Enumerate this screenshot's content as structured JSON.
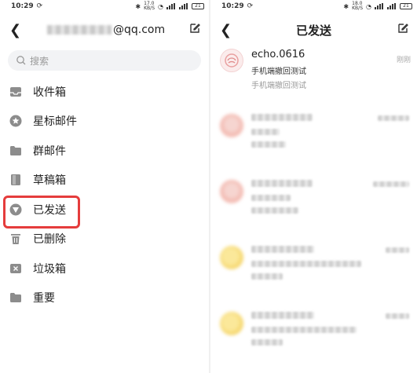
{
  "left": {
    "status": {
      "time": "10:29",
      "speed": "17.0\nKB/S",
      "battery": "21"
    },
    "header": {
      "account_suffix": "@qq.com"
    },
    "search": {
      "placeholder": "搜索"
    },
    "folders": [
      {
        "label": "收件箱",
        "icon": "inbox-icon"
      },
      {
        "label": "星标邮件",
        "icon": "star-icon"
      },
      {
        "label": "群邮件",
        "icon": "folder-icon"
      },
      {
        "label": "草稿箱",
        "icon": "draft-icon"
      },
      {
        "label": "已发送",
        "icon": "sent-icon",
        "highlighted": true
      },
      {
        "label": "已删除",
        "icon": "trash-icon"
      },
      {
        "label": "垃圾箱",
        "icon": "spam-icon"
      },
      {
        "label": "重要",
        "icon": "folder-icon"
      }
    ]
  },
  "right": {
    "status": {
      "time": "10:29",
      "speed": "18.0\nKB/S",
      "battery": "21"
    },
    "header": {
      "title": "已发送"
    },
    "mails": [
      {
        "sender": "echo.0616",
        "subject": "手机端撤回测试",
        "preview": "手机端撤回测试",
        "time": "刚刚"
      }
    ]
  },
  "colors": {
    "highlight": "#e53c3c",
    "icon_gray": "#8c8c8c",
    "search_bg": "#f2f3f5"
  }
}
